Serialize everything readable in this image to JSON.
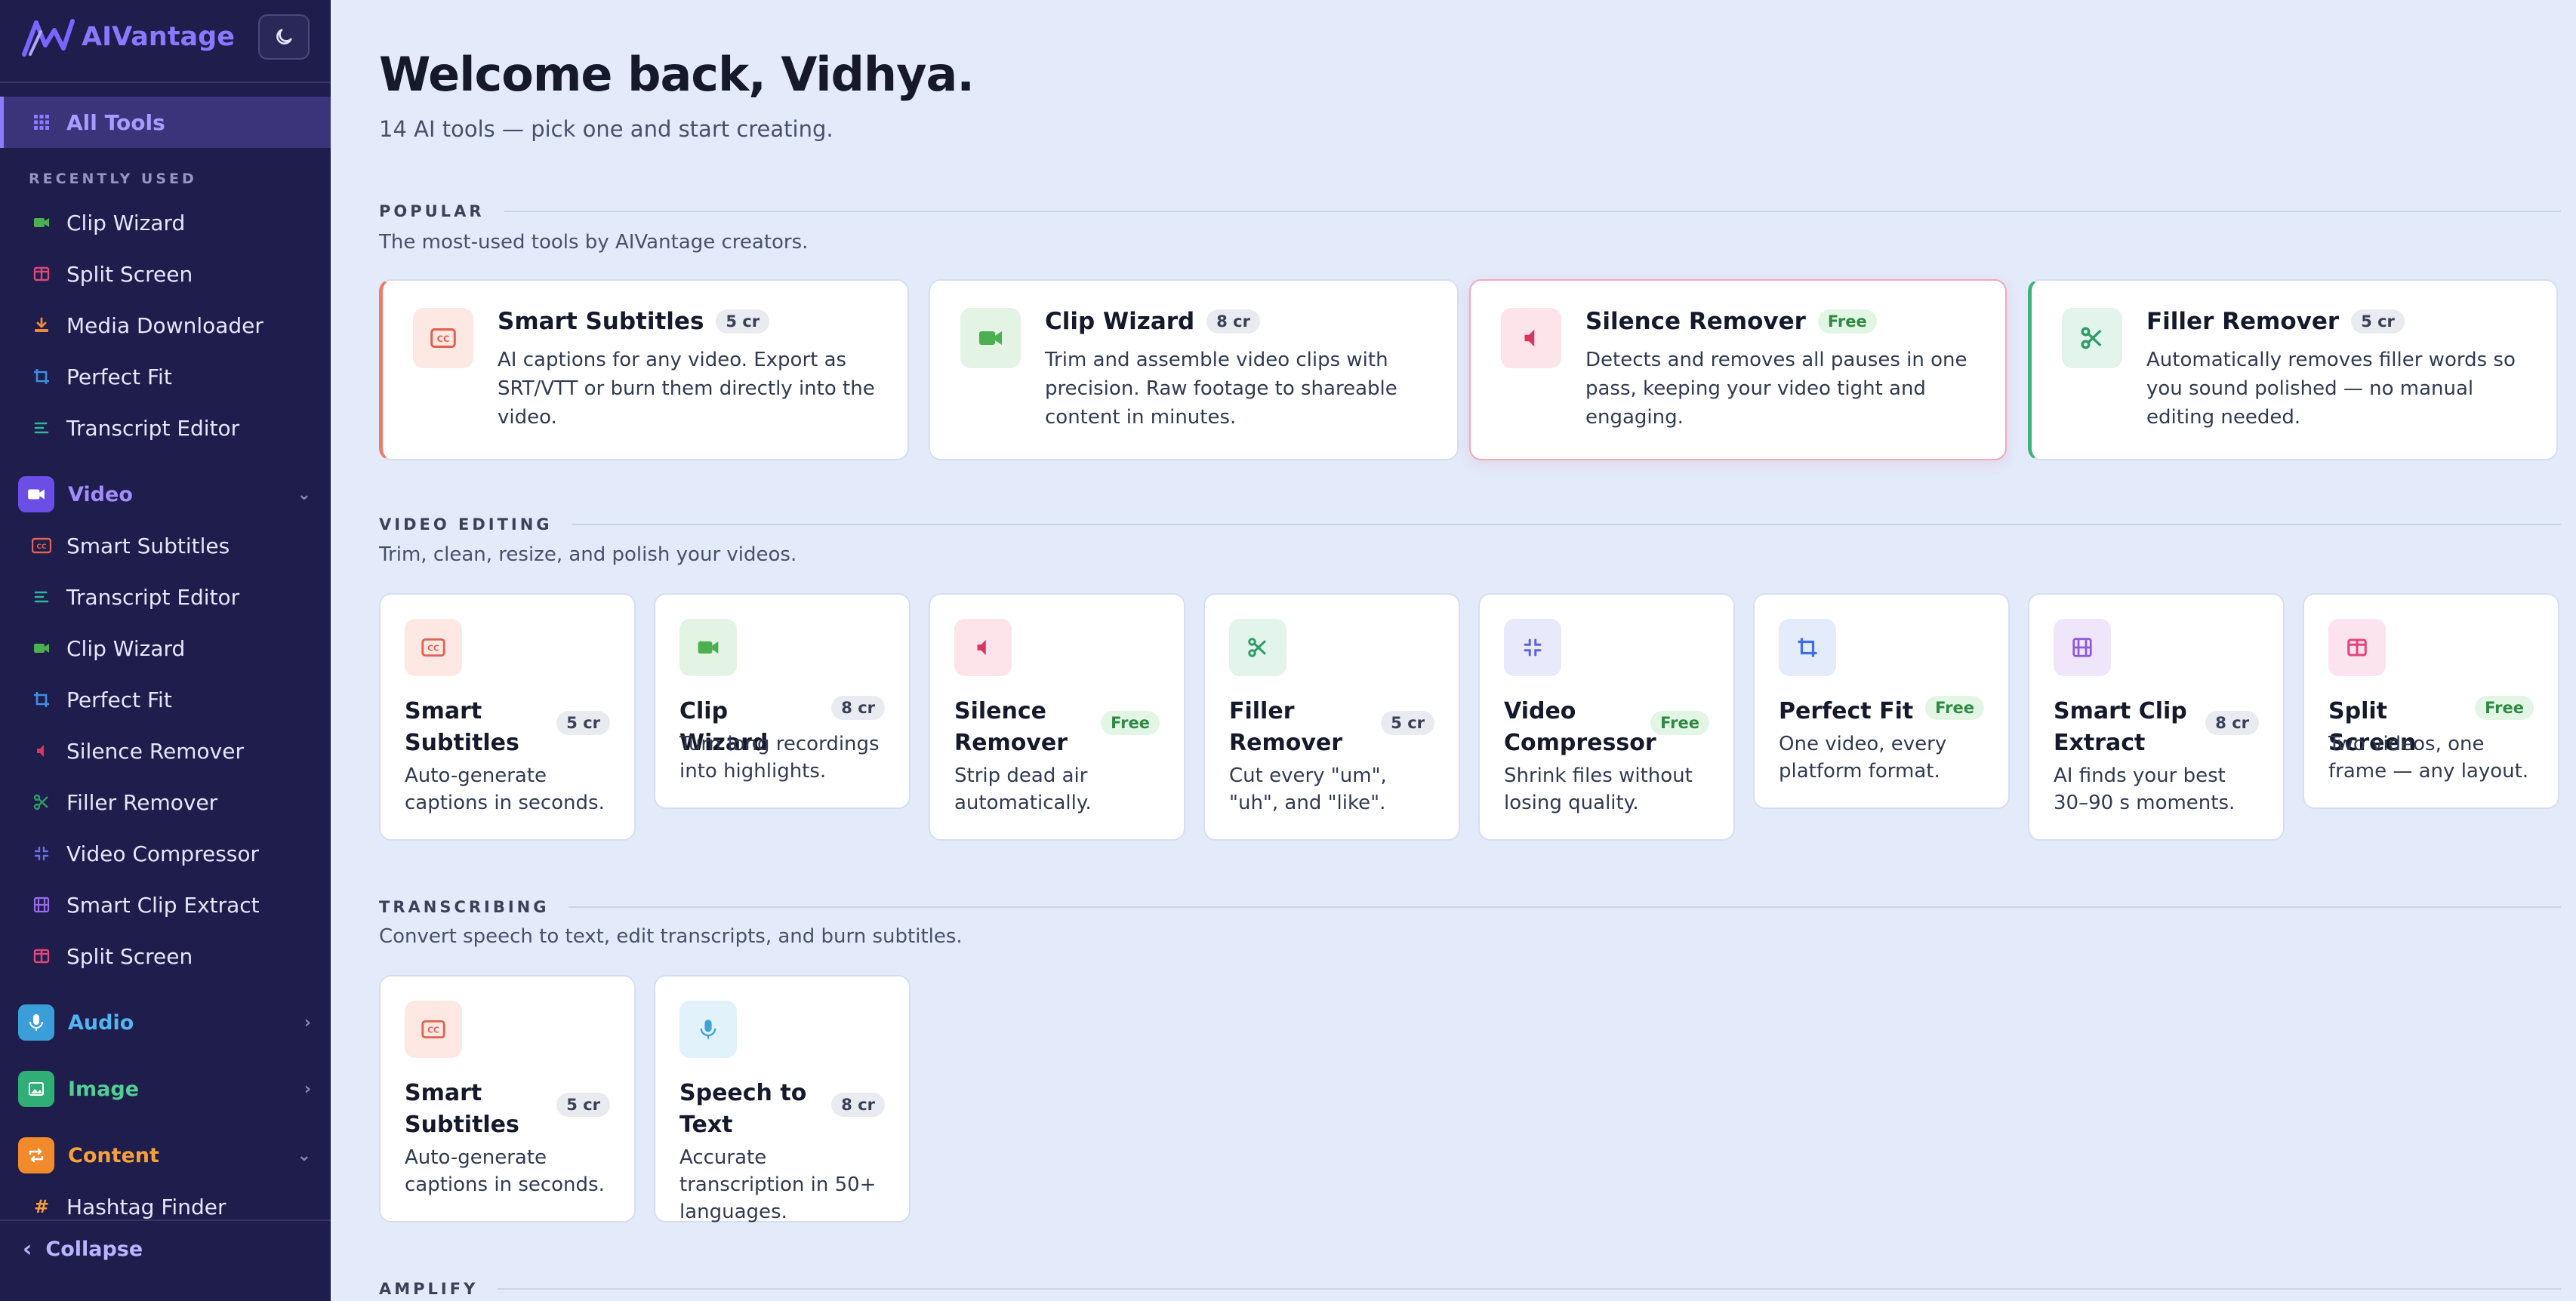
{
  "brand": {
    "name": "AIVantage"
  },
  "sidebar": {
    "all_tools": "All Tools",
    "recently_used_label": "RECENTLY USED",
    "recent": [
      "Clip Wizard",
      "Split Screen",
      "Media Downloader",
      "Perfect Fit",
      "Transcript Editor"
    ],
    "categories": {
      "video": "Video",
      "audio": "Audio",
      "image": "Image",
      "content": "Content"
    },
    "video_items": [
      "Smart Subtitles",
      "Transcript Editor",
      "Clip Wizard",
      "Perfect Fit",
      "Silence Remover",
      "Filler Remover",
      "Video Compressor",
      "Smart Clip Extract",
      "Split Screen"
    ],
    "content_items": [
      "Hashtag Finder"
    ],
    "collapse": "Collapse"
  },
  "header": {
    "welcome": "Welcome back, Vidhya.",
    "subtitle": "14 AI tools — pick one and start creating."
  },
  "popular": {
    "title": "POPULAR",
    "desc": "The most-used tools by AIVantage creators.",
    "cards": [
      {
        "name": "Smart Subtitles",
        "badge": "5 cr",
        "desc": "AI captions for any video. Export as SRT/VTT or burn them directly into the video."
      },
      {
        "name": "Clip Wizard",
        "badge": "8 cr",
        "desc": "Trim and assemble video clips with precision. Raw footage to shareable content in minutes."
      },
      {
        "name": "Silence Remover",
        "badge": "Free",
        "desc": "Detects and removes all pauses in one pass, keeping your video tight and engaging."
      },
      {
        "name": "Filler Remover",
        "badge": "5 cr",
        "desc": "Automatically removes filler words so you sound polished — no manual editing needed."
      }
    ]
  },
  "video_editing": {
    "title": "VIDEO EDITING",
    "desc": "Trim, clean, resize, and polish your videos.",
    "cards": [
      {
        "name": "Smart Subtitles",
        "badge": "5 cr",
        "desc": "Auto-generate captions in seconds."
      },
      {
        "name": "Clip Wizard",
        "badge": "8 cr",
        "desc": "Turn long recordings into highlights."
      },
      {
        "name": "Silence Remover",
        "badge": "Free",
        "desc": "Strip dead air automatically."
      },
      {
        "name": "Filler Remover",
        "badge": "5 cr",
        "desc": "Cut every \"um\", \"uh\", and \"like\"."
      },
      {
        "name": "Video Compressor",
        "badge": "Free",
        "desc": "Shrink files without losing quality."
      },
      {
        "name": "Perfect Fit",
        "badge": "Free",
        "desc": "One video, every platform format."
      },
      {
        "name": "Smart Clip Extract",
        "badge": "8 cr",
        "desc": "AI finds your best 30–90 s moments."
      },
      {
        "name": "Split Screen",
        "badge": "Free",
        "desc": "Two videos, one frame — any layout."
      }
    ]
  },
  "transcribing": {
    "title": "TRANSCRIBING",
    "desc": "Convert speech to text, edit transcripts, and burn subtitles.",
    "cards": [
      {
        "name": "Smart Subtitles",
        "badge": "5 cr",
        "desc": "Auto-generate captions in seconds."
      },
      {
        "name": "Speech to Text",
        "badge": "8 cr",
        "desc": "Accurate transcription in 50+ languages."
      }
    ]
  },
  "amplify": {
    "title": "AMPLIFY"
  },
  "colors": {
    "sidebar_bg": "#1f1d4b",
    "accent": "#8a78ff",
    "page_bg": "#e3ebfb",
    "subtitle_red": "#e0624f",
    "clip_green": "#4caf50",
    "silence_pink": "#d6365f",
    "filler_green": "#2e9c67",
    "compressor_indigo": "#5b63d8",
    "fit_blue": "#3d6fe0",
    "extract_purple": "#8a5ad8",
    "split_pink": "#e0457a",
    "speech_blue": "#3fa3d6"
  }
}
